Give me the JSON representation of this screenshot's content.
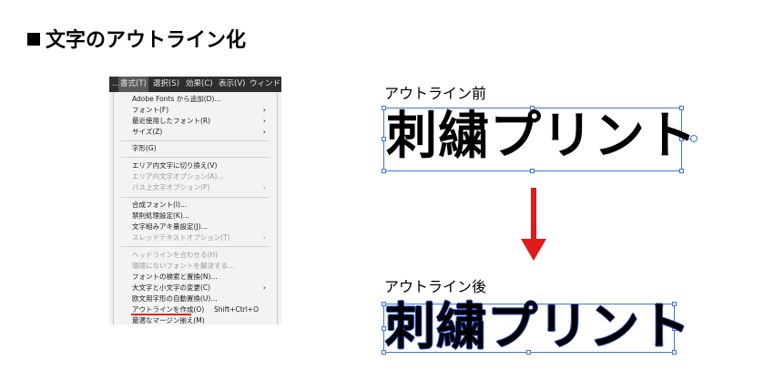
{
  "title": "文字のアウトライン化",
  "menubar": {
    "items": [
      "書式(T)",
      "選択(S)",
      "効果(C)",
      "表示(V)",
      "ウィンドウ(W"
    ]
  },
  "menu": {
    "items": [
      {
        "label": "Adobe Fonts から追加(D)...",
        "submenu": false,
        "enabled": true
      },
      {
        "label": "フォント(F)",
        "submenu": true,
        "enabled": true
      },
      {
        "label": "最近使用したフォント(R)",
        "submenu": true,
        "enabled": true
      },
      {
        "label": "サイズ(Z)",
        "submenu": true,
        "enabled": true
      },
      {
        "label": "字形(G)",
        "submenu": false,
        "enabled": true
      },
      {
        "label": "エリア内文字に切り換え(V)",
        "submenu": false,
        "enabled": true
      },
      {
        "label": "エリア内文字オプション(A)...",
        "submenu": false,
        "enabled": false
      },
      {
        "label": "パス上文字オプション(P)",
        "submenu": true,
        "enabled": false
      },
      {
        "label": "合成フォント(I)...",
        "submenu": false,
        "enabled": true
      },
      {
        "label": "禁則処理設定(K)...",
        "submenu": false,
        "enabled": true
      },
      {
        "label": "文字組みアキ量設定(J)...",
        "submenu": false,
        "enabled": true
      },
      {
        "label": "スレッドテキストオプション(T)",
        "submenu": true,
        "enabled": false
      },
      {
        "label": "ヘッドラインを合わせる(H)",
        "submenu": false,
        "enabled": false
      },
      {
        "label": "環境にないフォントを解決する...",
        "submenu": false,
        "enabled": false
      },
      {
        "label": "フォントの検索と置換(N)...",
        "submenu": false,
        "enabled": true
      },
      {
        "label": "大文字と小文字の変更(C)",
        "submenu": true,
        "enabled": true
      },
      {
        "label": "欧文用字形の自動置換(U)...",
        "submenu": false,
        "enabled": true
      },
      {
        "label": "アウトラインを作成(O)",
        "shortcut": "Shift+Ctrl+O",
        "submenu": false,
        "enabled": true,
        "highlighted": true
      },
      {
        "label": "最適なマージン揃え(M)",
        "submenu": false,
        "enabled": true
      }
    ]
  },
  "demo": {
    "before_caption": "アウトライン前",
    "after_caption": "アウトライン後",
    "sample_text": "刺繍プリント"
  },
  "colors": {
    "selection": "#3d73e6",
    "arrow": "#e11a1a",
    "underline": "#e0221c"
  }
}
